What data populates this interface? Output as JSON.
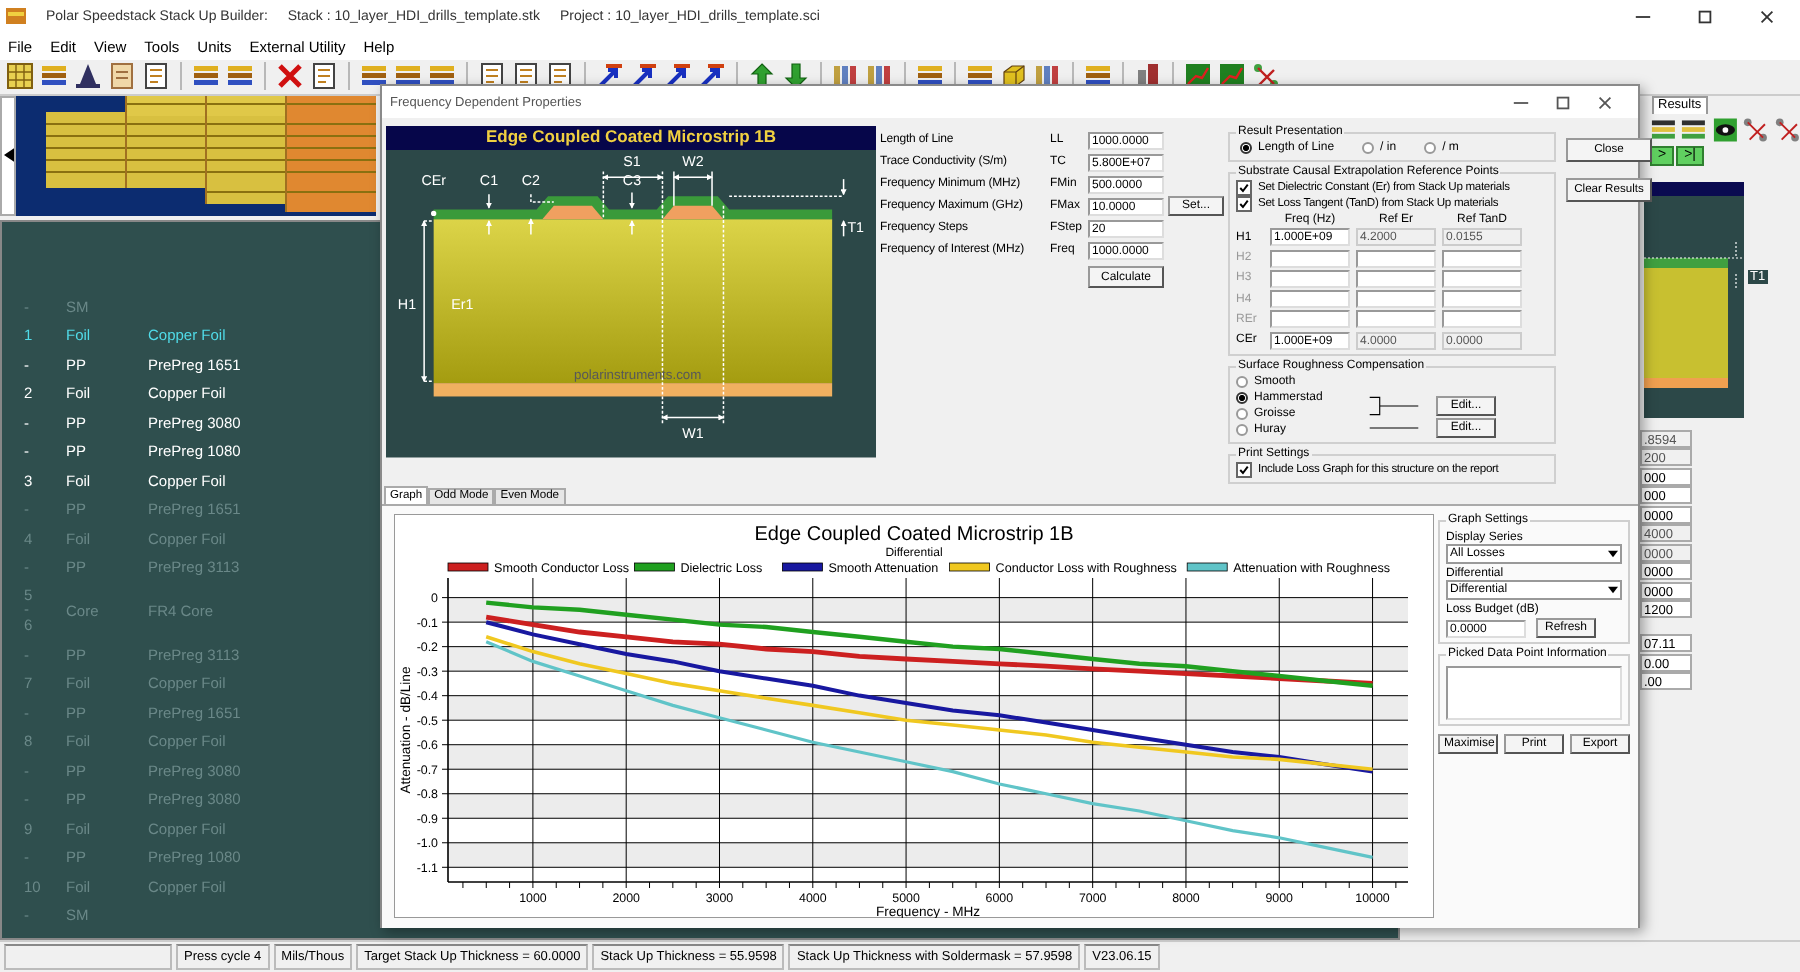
{
  "window": {
    "title": "Polar Speedstack Stack Up Builder:",
    "stack": "Stack : 10_layer_HDI_drills_template.stk",
    "project": "Project : 10_layer_HDI_drills_template.sci"
  },
  "menu": [
    "File",
    "Edit",
    "View",
    "Tools",
    "Units",
    "External Utility",
    "Help"
  ],
  "layers": [
    {
      "kind": "layer",
      "number": "-",
      "type": "SM",
      "selected": false,
      "dim": true
    },
    {
      "kind": "layer",
      "number": "1",
      "type": "Foil",
      "material": "Copper Foil",
      "selected": true,
      "dim": false
    },
    {
      "kind": "layer",
      "number": "-",
      "type": "PP",
      "material": "PrePreg 1651",
      "selected": false,
      "dim": false
    },
    {
      "kind": "layer",
      "number": "2",
      "type": "Foil",
      "material": "Copper Foil",
      "selected": false,
      "dim": false
    },
    {
      "kind": "layer",
      "number": "-",
      "type": "PP",
      "material": "PrePreg 3080",
      "selected": false,
      "dim": false
    },
    {
      "kind": "layer",
      "number": "-",
      "type": "PP",
      "material": "PrePreg 1080",
      "selected": false,
      "dim": false
    },
    {
      "kind": "layer",
      "number": "3",
      "type": "Foil",
      "material": "Copper Foil",
      "selected": false,
      "dim": false
    },
    {
      "kind": "layer",
      "number": "-",
      "type": "PP",
      "material": "PrePreg 1651",
      "selected": false,
      "dim": true
    },
    {
      "kind": "layer",
      "number": "4",
      "type": "Foil",
      "material": "Copper Foil",
      "selected": false,
      "dim": true
    },
    {
      "kind": "layer",
      "number": "-",
      "type": "PP",
      "material": "PrePreg 3113",
      "selected": false,
      "dim": true
    },
    {
      "kind": "core",
      "number": "5 - 6",
      "type": "Core",
      "material": "FR4 Core",
      "selected": false,
      "dim": true
    },
    {
      "kind": "layer",
      "number": "-",
      "type": "PP",
      "material": "PrePreg 3113",
      "selected": false,
      "dim": true
    },
    {
      "kind": "layer",
      "number": "7",
      "type": "Foil",
      "material": "Copper Foil",
      "selected": false,
      "dim": true
    },
    {
      "kind": "layer",
      "number": "-",
      "type": "PP",
      "material": "PrePreg 1651",
      "selected": false,
      "dim": true
    },
    {
      "kind": "layer",
      "number": "8",
      "type": "Foil",
      "material": "Copper Foil",
      "selected": false,
      "dim": true
    },
    {
      "kind": "layer",
      "number": "-",
      "type": "PP",
      "material": "PrePreg 3080",
      "selected": false,
      "dim": true
    },
    {
      "kind": "layer",
      "number": "-",
      "type": "PP",
      "material": "PrePreg 3080",
      "selected": false,
      "dim": true
    },
    {
      "kind": "layer",
      "number": "9",
      "type": "Foil",
      "material": "Copper Foil",
      "selected": false,
      "dim": true
    },
    {
      "kind": "layer",
      "number": "-",
      "type": "PP",
      "material": "PrePreg 1080",
      "selected": false,
      "dim": true
    },
    {
      "kind": "layer",
      "number": "10",
      "type": "Foil",
      "material": "Copper Foil",
      "selected": false,
      "dim": true
    },
    {
      "kind": "layer",
      "number": "-",
      "type": "SM",
      "selected": false,
      "dim": true
    }
  ],
  "right_panel": {
    "tab": "Results",
    "nav_buttons": [
      ">",
      ">|"
    ],
    "preview_label": "T1",
    "fields": [
      {
        "value": ".8594",
        "disabled": true
      },
      {
        "value": "200",
        "disabled": true
      },
      {
        "value": "000",
        "disabled": false
      },
      {
        "value": "000",
        "disabled": false
      },
      {
        "value": "0000",
        "disabled": false
      },
      {
        "value": "4000",
        "disabled": true
      },
      {
        "value": "0000",
        "disabled": true
      },
      {
        "value": "0000",
        "disabled": false
      },
      {
        "value": "0000",
        "disabled": false
      },
      {
        "value": "1200",
        "disabled": false
      }
    ],
    "totals": [
      {
        "value": "07.11",
        "disabled": false
      },
      {
        "value": "0.00",
        "disabled": false
      },
      {
        "value": ".00",
        "disabled": false
      }
    ]
  },
  "dialog": {
    "title": "Frequency Dependent Properties",
    "diagram": {
      "title": "Edge Coupled Coated Microstrip 1B",
      "labels": [
        "CEr",
        "C1",
        "C2",
        "S1",
        "C3",
        "W2",
        "T1",
        "H1",
        "Er1",
        "W1"
      ],
      "caption": "polarinstruments.com"
    },
    "parameters": [
      {
        "label": "Length of Line",
        "symbol": "LL",
        "value": "1000.0000"
      },
      {
        "label": "Trace Conductivity (S/m)",
        "symbol": "TC",
        "value": "5.800E+07"
      },
      {
        "label": "Frequency Minimum (MHz)",
        "symbol": "FMin",
        "value": "500.0000"
      },
      {
        "label": "Frequency Maximum (GHz)",
        "symbol": "FMax",
        "value": "10.0000",
        "button": "Set..."
      },
      {
        "label": "Frequency Steps",
        "symbol": "FStep",
        "value": "20"
      },
      {
        "label": "Frequency of Interest (MHz)",
        "symbol": "Freq",
        "value": "1000.0000"
      }
    ],
    "calculate_button": "Calculate",
    "result_presentation": {
      "title": "Result Presentation",
      "options": [
        {
          "label": "Length of Line",
          "selected": true
        },
        {
          "label": "/ in",
          "selected": false
        },
        {
          "label": "/ m",
          "selected": false
        }
      ]
    },
    "substrate": {
      "title": "Substrate Causal Extrapolation Reference Points",
      "checks": [
        {
          "label": "Set Dielectric Constant (Er) from Stack Up materials",
          "checked": true
        },
        {
          "label": "Set Loss Tangent (TanD) from Stack Up materials",
          "checked": true
        }
      ],
      "columns": [
        "Freq (Hz)",
        "Ref Er",
        "Ref TanD"
      ],
      "rows": [
        {
          "label": "H1",
          "disabled": false,
          "cells": [
            {
              "value": "1.000E+09",
              "disabled": false
            },
            {
              "value": "4.2000",
              "disabled": true
            },
            {
              "value": "0.0155",
              "disabled": true
            }
          ]
        },
        {
          "label": "H2",
          "disabled": true,
          "cells": [
            {
              "disabled": false
            },
            {
              "disabled": false
            },
            {
              "disabled": false
            }
          ]
        },
        {
          "label": "H3",
          "disabled": true,
          "cells": [
            {
              "disabled": false
            },
            {
              "disabled": false
            },
            {
              "disabled": false
            }
          ]
        },
        {
          "label": "H4",
          "disabled": true,
          "cells": [
            {
              "disabled": false
            },
            {
              "disabled": false
            },
            {
              "disabled": false
            }
          ]
        },
        {
          "label": "REr",
          "disabled": true,
          "cells": [
            {
              "disabled": false
            },
            {
              "disabled": false
            },
            {
              "disabled": false
            }
          ]
        },
        {
          "label": "CEr",
          "disabled": false,
          "cells": [
            {
              "value": "1.000E+09",
              "disabled": false
            },
            {
              "value": "4.0000",
              "disabled": true
            },
            {
              "value": "0.0000",
              "disabled": true
            }
          ]
        }
      ]
    },
    "roughness": {
      "title": "Surface Roughness Compensation",
      "options": [
        {
          "label": "Smooth",
          "selected": false
        },
        {
          "label": "Hammerstad",
          "selected": true
        },
        {
          "label": "Groisse",
          "selected": false
        },
        {
          "label": "Huray",
          "selected": false
        }
      ],
      "edit_buttons": [
        "Edit...",
        "Edit..."
      ]
    },
    "print_settings": {
      "title": "Print Settings",
      "label": "Include Loss Graph for this structure on the report",
      "checked": true
    },
    "buttons": [
      "Close",
      "Clear Results"
    ],
    "tabs": [
      {
        "label": "Graph",
        "selected": true
      },
      {
        "label": "Odd Mode",
        "selected": false
      },
      {
        "label": "Even Mode",
        "selected": false
      }
    ],
    "graph": {
      "subtitle": "Differential",
      "chart_data": {
        "type": "line",
        "title": "Edge Coupled Coated Microstrip 1B",
        "xlabel": "Frequency - MHz",
        "ylabel": "Attenuation - dB/Line",
        "x": [
          500,
          1000,
          1500,
          2000,
          2500,
          3000,
          3500,
          4000,
          4500,
          5000,
          5500,
          6000,
          6500,
          7000,
          7500,
          8000,
          8500,
          9000,
          9500,
          10000
        ],
        "series": [
          {
            "name": "Smooth Conductor Loss",
            "color": "#cc2020",
            "values": [
              -0.08,
              -0.11,
              -0.14,
              -0.16,
              -0.18,
              -0.19,
              -0.21,
              -0.22,
              -0.24,
              -0.25,
              -0.26,
              -0.27,
              -0.28,
              -0.29,
              -0.3,
              -0.31,
              -0.32,
              -0.33,
              -0.34,
              -0.35
            ]
          },
          {
            "name": "Dielectric Loss",
            "color": "#20a020",
            "values": [
              -0.02,
              -0.04,
              -0.05,
              -0.07,
              -0.09,
              -0.11,
              -0.12,
              -0.14,
              -0.16,
              -0.18,
              -0.2,
              -0.21,
              -0.23,
              -0.25,
              -0.27,
              -0.28,
              -0.3,
              -0.32,
              -0.34,
              -0.36
            ]
          },
          {
            "name": "Smooth Attenuation",
            "color": "#1818a0",
            "values": [
              -0.1,
              -0.15,
              -0.19,
              -0.23,
              -0.26,
              -0.3,
              -0.33,
              -0.36,
              -0.4,
              -0.43,
              -0.46,
              -0.48,
              -0.51,
              -0.54,
              -0.57,
              -0.6,
              -0.63,
              -0.65,
              -0.68,
              -0.71
            ]
          },
          {
            "name": "Conductor Loss with Roughness",
            "color": "#f0c820",
            "values": [
              -0.16,
              -0.22,
              -0.27,
              -0.31,
              -0.35,
              -0.38,
              -0.41,
              -0.44,
              -0.47,
              -0.5,
              -0.52,
              -0.54,
              -0.56,
              -0.59,
              -0.61,
              -0.63,
              -0.65,
              -0.66,
              -0.68,
              -0.7
            ]
          },
          {
            "name": "Attenuation with Roughness",
            "color": "#60c4c8",
            "values": [
              -0.18,
              -0.26,
              -0.32,
              -0.38,
              -0.44,
              -0.49,
              -0.54,
              -0.59,
              -0.63,
              -0.67,
              -0.71,
              -0.76,
              -0.8,
              -0.84,
              -0.87,
              -0.91,
              -0.95,
              -0.98,
              -1.02,
              -1.06
            ]
          }
        ],
        "grid": true,
        "legend": "top",
        "xlim": [
          90,
          10380
        ],
        "ylim": [
          -1.16,
          0.08
        ],
        "xticks": [
          1000,
          2000,
          3000,
          4000,
          5000,
          6000,
          7000,
          8000,
          9000,
          10000
        ],
        "yticks": [
          0,
          -0.1,
          -0.2,
          -0.3,
          -0.4,
          -0.5,
          -0.6,
          -0.7,
          -0.8,
          -0.9,
          {
            "value": -1,
            "label": "-1.0"
          },
          -1.1
        ]
      }
    },
    "graph_settings": {
      "title": "Graph Settings",
      "display_series_label": "Display Series",
      "display_series": "All Losses",
      "mode_label": "Differential",
      "mode": "Differential",
      "loss_budget_label": "Loss Budget (dB)",
      "loss_budget": "0.0000",
      "refresh": "Refresh",
      "picked_title": "Picked Data Point Information",
      "buttons": [
        "Maximise",
        "Print",
        "Export"
      ]
    }
  },
  "status_bar": [
    "Press cycle 4",
    "Mils/Thous",
    "Target Stack Up Thickness = 60.0000",
    "Stack Up Thickness = 55.9598",
    "Stack Up Thickness with Soldermask = 57.9598",
    "V23.06.15"
  ]
}
